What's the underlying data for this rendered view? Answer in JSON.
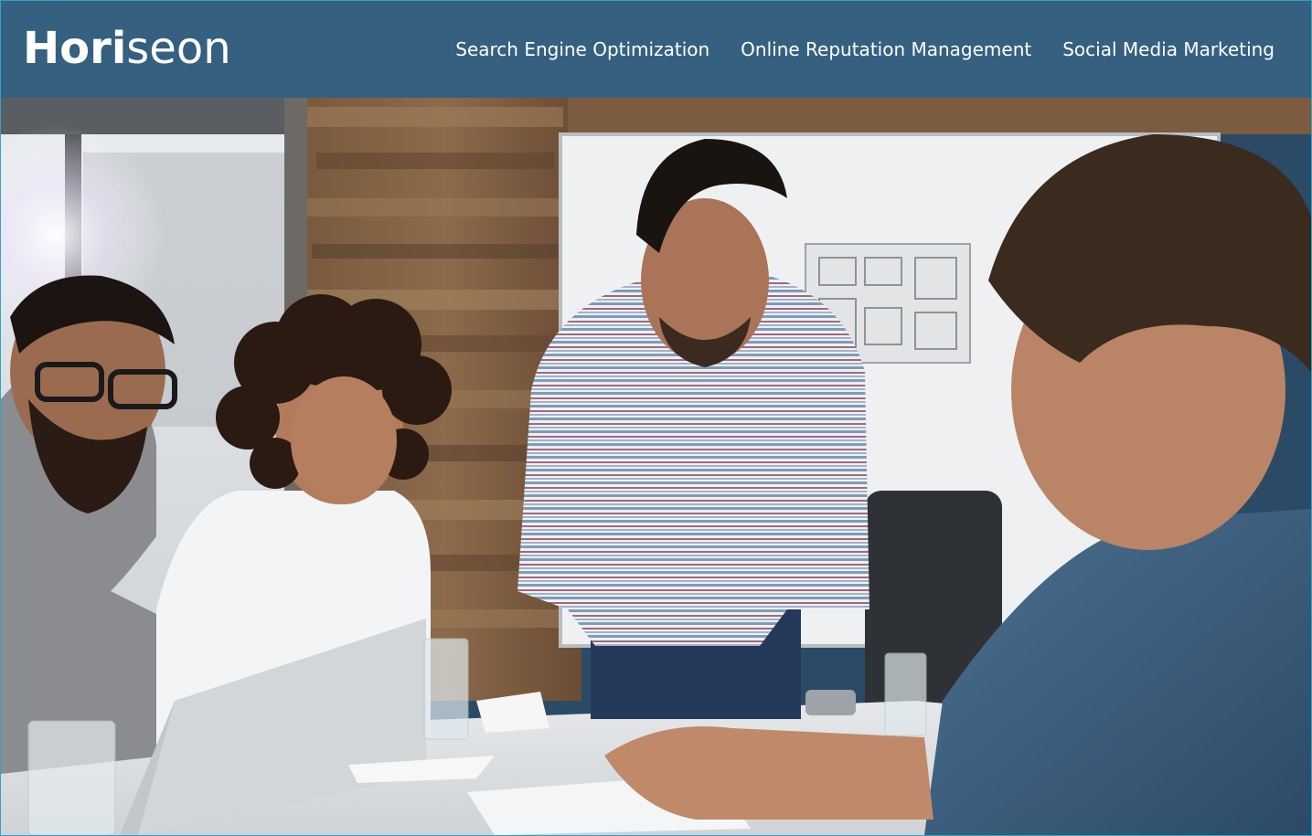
{
  "header": {
    "logo_bold": "Hori",
    "logo_light": "seon",
    "nav": [
      {
        "label": "Search Engine Optimization"
      },
      {
        "label": "Online Reputation Management"
      },
      {
        "label": "Social Media Marketing"
      }
    ]
  },
  "colors": {
    "header_bg": "#35607f",
    "header_text": "#ffffff",
    "frame_border": "#2aa7c6"
  },
  "hero": {
    "image_subject": "team-meeting-photo"
  }
}
